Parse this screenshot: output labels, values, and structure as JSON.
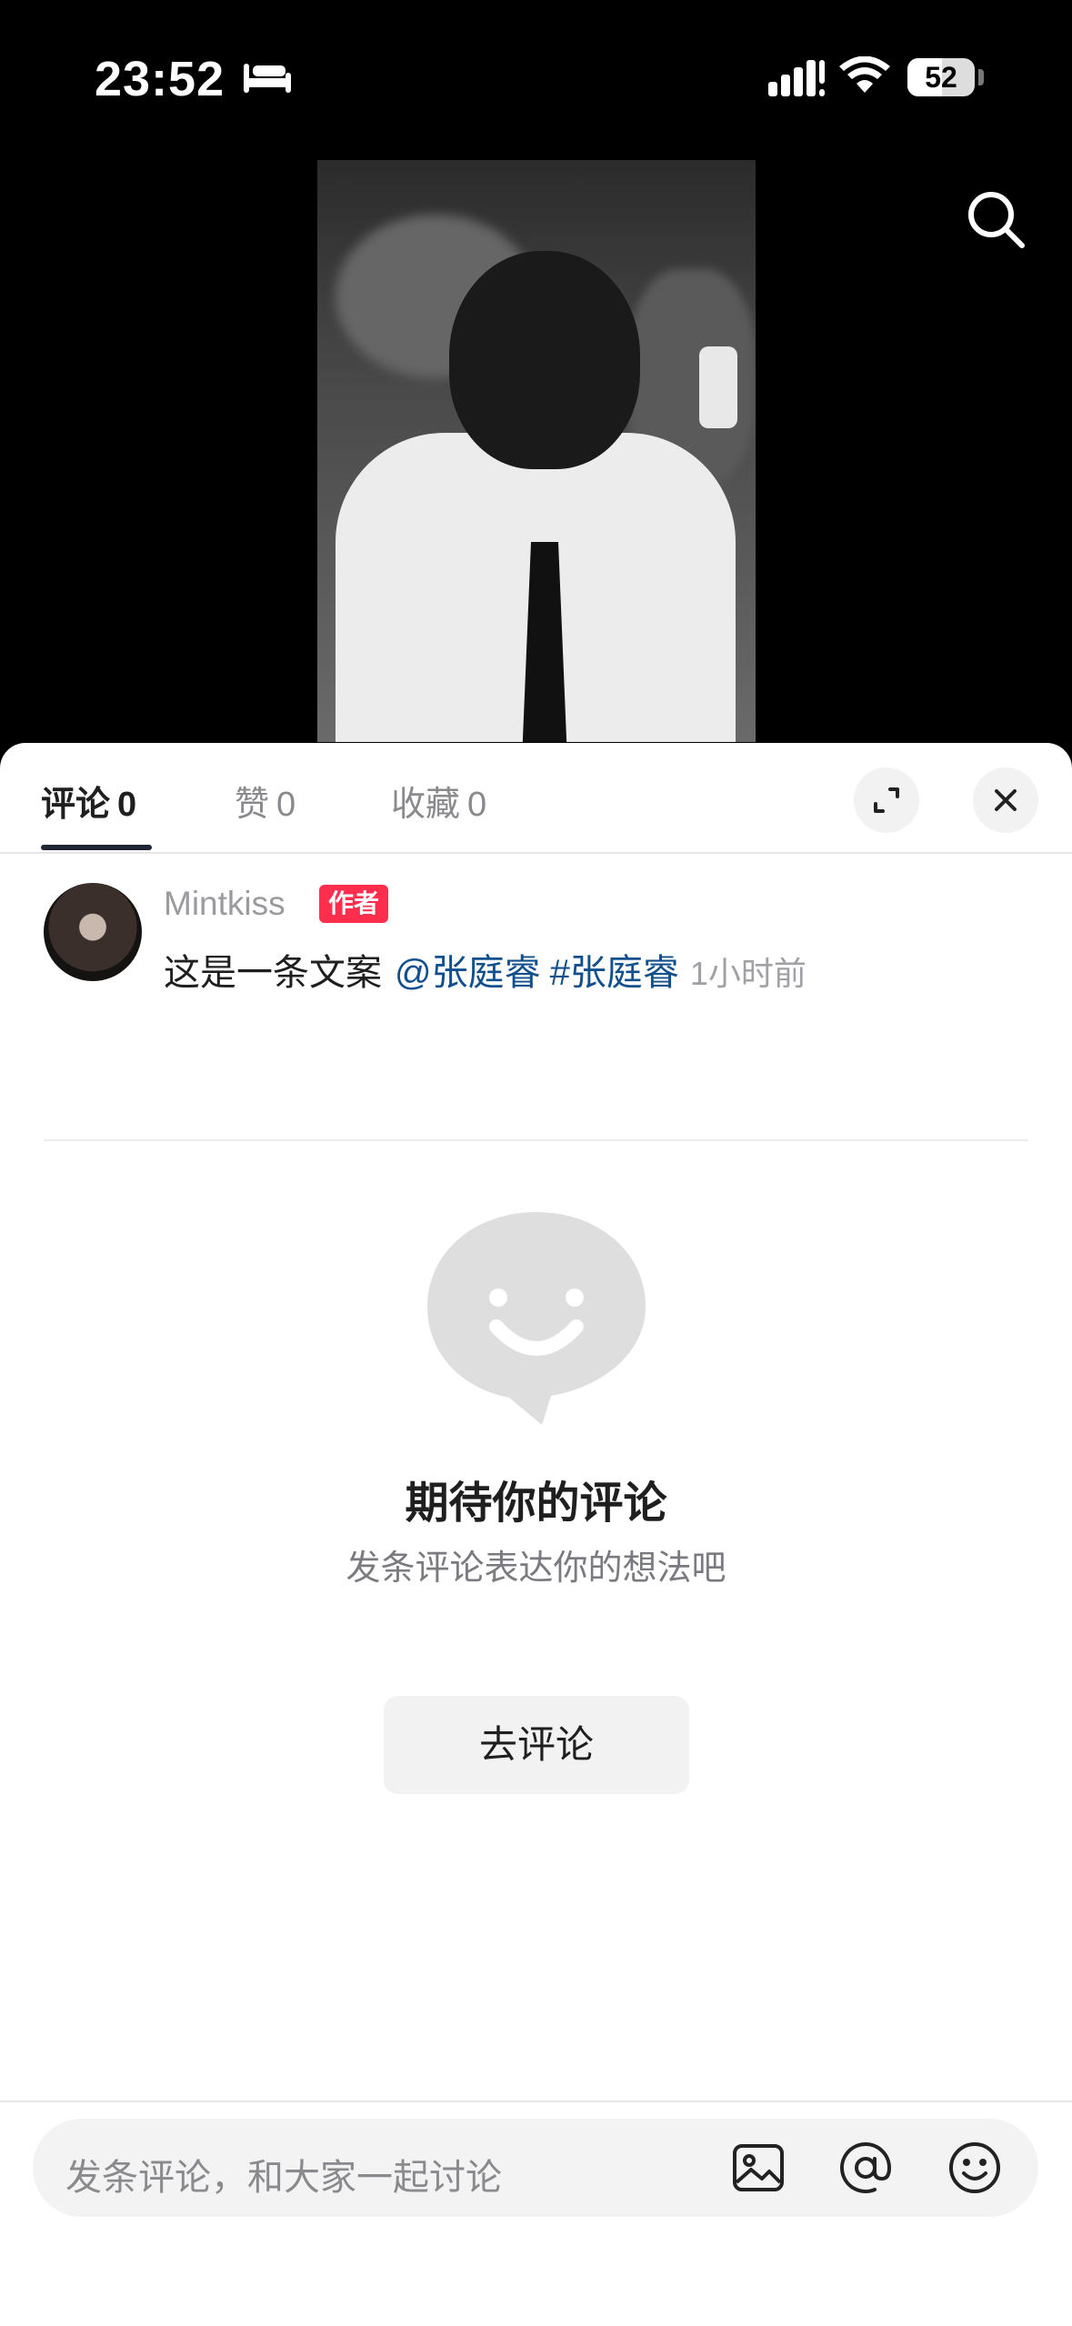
{
  "status_bar": {
    "time": "23:52",
    "battery": "52"
  },
  "tabs": [
    {
      "label": "评论",
      "count": "0"
    },
    {
      "label": "赞",
      "count": "0"
    },
    {
      "label": "收藏",
      "count": "0"
    }
  ],
  "post": {
    "username": "Mintkiss",
    "badge": "作者",
    "text": "这是一条文案",
    "mention": "@张庭睿",
    "hashtag": "#张庭睿",
    "time": "1小时前"
  },
  "empty": {
    "title": "期待你的评论",
    "subtitle": "发条评论表达你的想法吧",
    "button": "去评论"
  },
  "input": {
    "placeholder": "发条评论，和大家一起讨论"
  },
  "colors": {
    "accent_red": "#ff2e4d",
    "link_blue": "#12508d"
  }
}
